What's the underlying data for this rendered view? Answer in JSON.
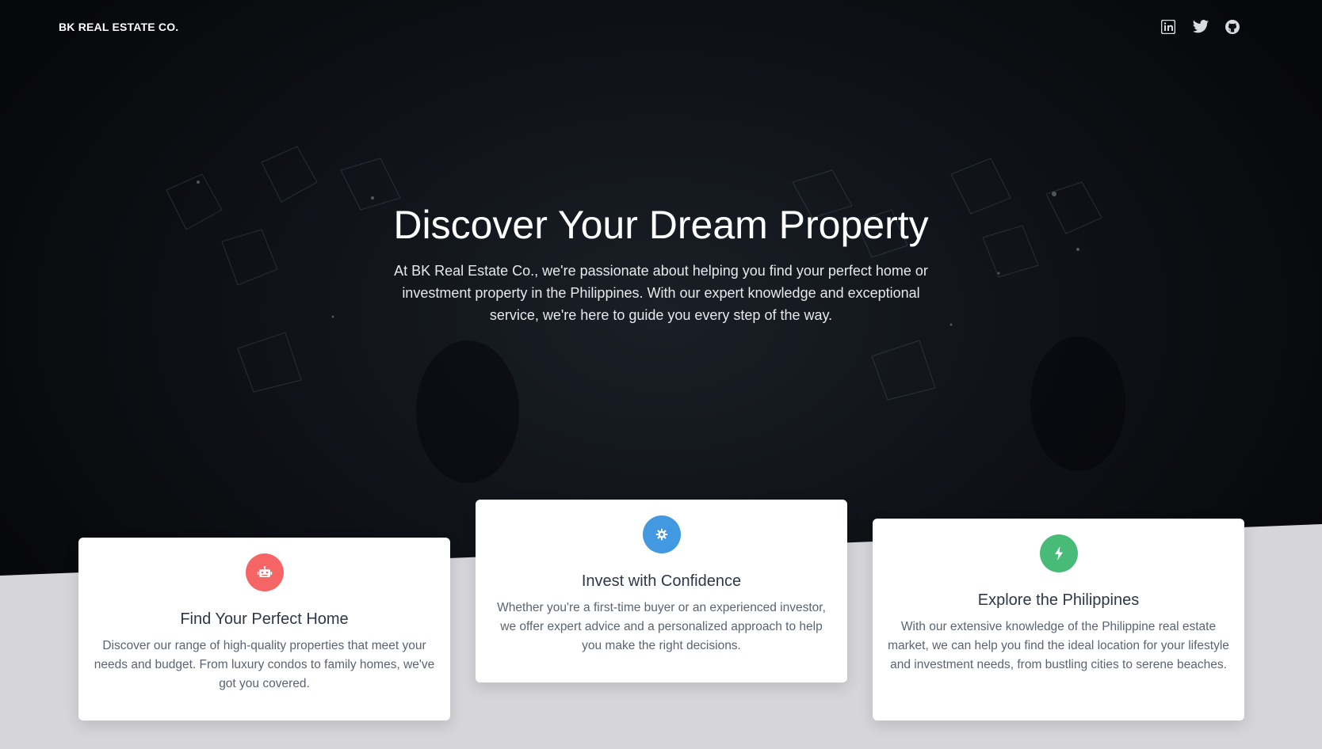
{
  "brand": "BK REAL ESTATE CO.",
  "nav": {
    "social_links": [
      {
        "icon": "linkedin-icon"
      },
      {
        "icon": "twitter-icon"
      },
      {
        "icon": "github-icon"
      }
    ]
  },
  "hero": {
    "title": "Discover Your Dream Property",
    "description": "At BK Real Estate Co., we're passionate about helping you find your perfect home or investment property in the Philippines. With our expert knowledge and exceptional service, we're here to guide you every step of the way."
  },
  "features": [
    {
      "icon": "robot-icon",
      "icon_color": "#f56565",
      "title": "Find Your Perfect Home",
      "text": "Discover our range of high-quality properties that meet your needs and budget. From luxury condos to family homes, we've got you covered."
    },
    {
      "icon": "gear-icon",
      "icon_color": "#4299e1",
      "title": "Invest with Confidence",
      "text": "Whether you're a first-time buyer or an experienced investor, we offer expert advice and a personalized approach to help you make the right decisions."
    },
    {
      "icon": "bolt-icon",
      "icon_color": "#48bb78",
      "title": "Explore the Philippines",
      "text": "With our extensive knowledge of the Philippine real estate market, we can help you find the ideal location for your lifestyle and investment needs, from bustling cities to serene beaches."
    }
  ],
  "colors": {
    "hero_bg": "#0a0c10",
    "lower_bg": "#d5d5da",
    "card_bg": "#ffffff"
  }
}
